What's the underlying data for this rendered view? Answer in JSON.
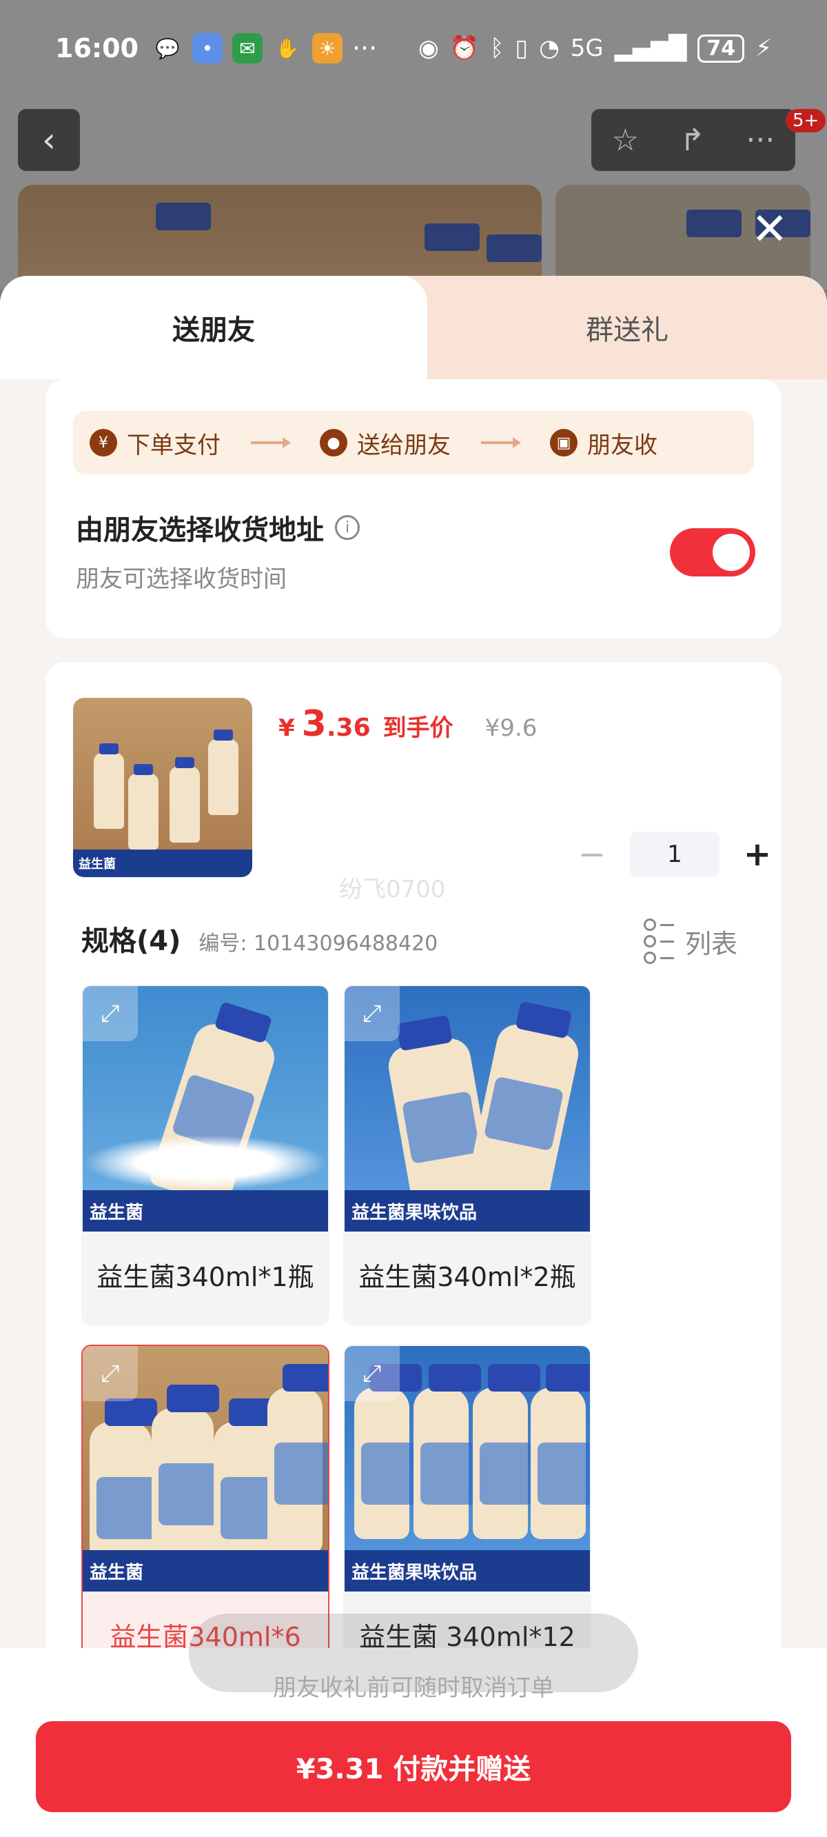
{
  "status_bar": {
    "time": "16:00",
    "network": "5G",
    "battery": "74"
  },
  "header": {
    "badge": "5+"
  },
  "tabs": {
    "active": "送朋友",
    "inactive": "群送礼"
  },
  "flow": {
    "steps": [
      "下单支付",
      "送给朋友",
      "朋友收"
    ]
  },
  "address": {
    "title": "由朋友选择收货地址",
    "subtitle": "朋友可选择收货时间",
    "toggle_on": true
  },
  "product": {
    "currency": "¥",
    "price_int": "3",
    "price_dec": ".36",
    "price_tag": "到手价",
    "original_price": "¥9.6",
    "quantity": "1",
    "thumb_banner": "益生菌",
    "watermark": "纷飞0700"
  },
  "spec": {
    "title": "规格(4)",
    "code": "编号: 10143096488420",
    "list_label": "列表",
    "items": [
      {
        "label": "益生菌340ml*1瓶",
        "banner": "益生菌"
      },
      {
        "label": "益生菌340ml*2瓶",
        "banner": "益生菌果味饮品"
      },
      {
        "label": "益生菌340ml*6",
        "banner": "益生菌"
      },
      {
        "label": "益生菌 340ml*12",
        "banner": "益生菌果味饮品"
      }
    ],
    "selected_index": 2
  },
  "toast": {
    "text": "朋友收礼前可随时取消订单"
  },
  "pay_button": {
    "label": "¥3.31 付款并赠送"
  },
  "colors": {
    "accent": "#f02f3a",
    "step_bg": "#fcefe4",
    "step_text": "#7a3b12",
    "tab_inactive": "#f9e3d6"
  }
}
